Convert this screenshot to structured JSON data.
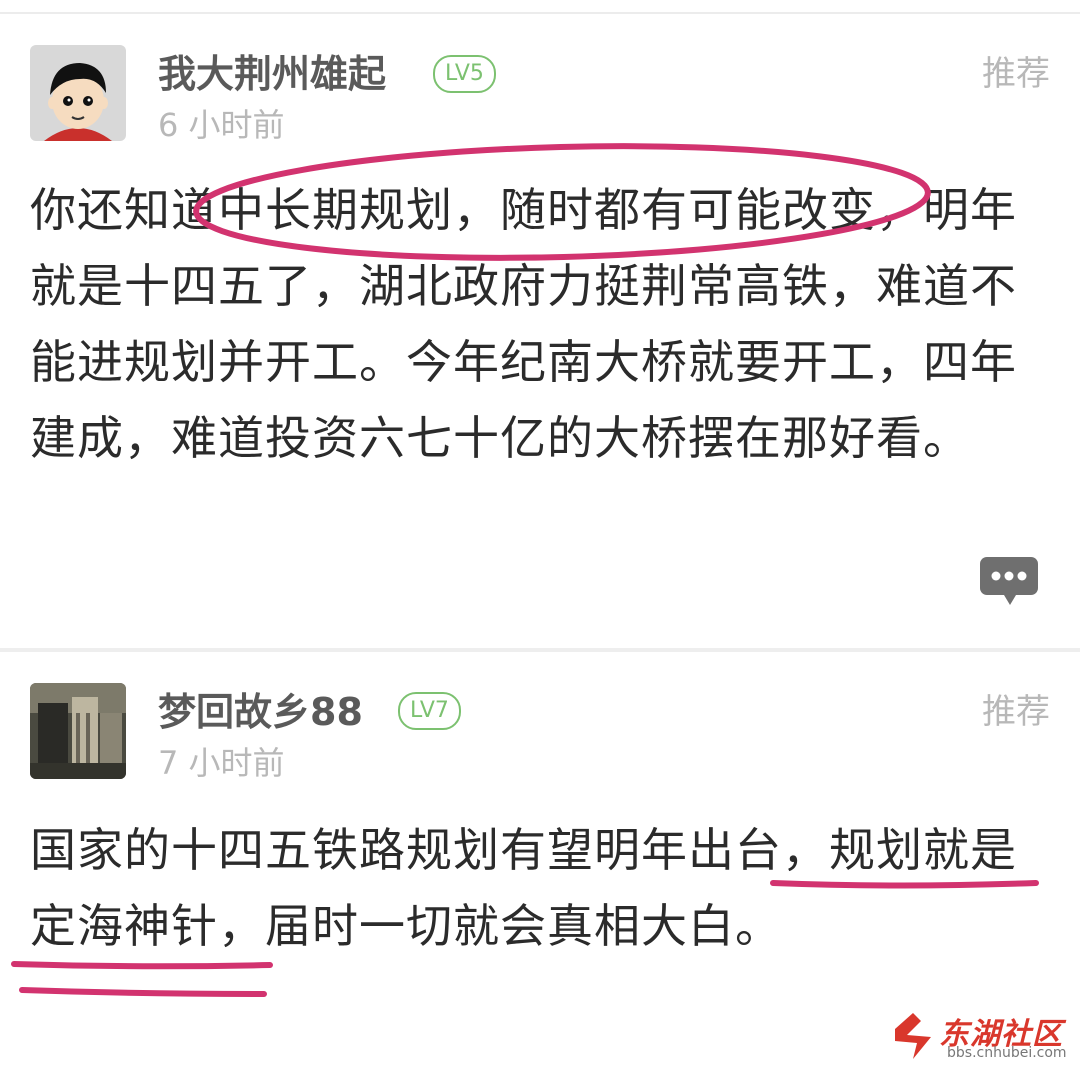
{
  "comments": [
    {
      "username": "我大荆州雄起",
      "level": "LV5",
      "time": "6 小时前",
      "recommend": "推荐",
      "content_lines": [
        "你还知道中长期规划，随时都有可能改变，明年",
        "就是十四五了，湖北政府力挺荆常高铁，难道不",
        "能进规划并开工。今年纪南大桥就要开工，四年",
        "建成，难道投资六七十亿的大桥摆在那好看。"
      ]
    },
    {
      "username": "梦回故乡88",
      "level": "LV7",
      "time": "7 小时前",
      "recommend": "推荐",
      "content_lines": [
        "国家的十四五铁路规划有望明年出台，规划就是",
        "定海神针，届时一切就会真相大白。"
      ]
    }
  ],
  "watermark": {
    "name": "东湖社区",
    "url": "bbs.cnhubei.com"
  },
  "colors": {
    "annotation": "#d2336f",
    "level_badge": "#7cc170",
    "watermark": "#d9372c"
  },
  "icons": {
    "more": "more-dots-bubble-icon",
    "avatar1": "cartoon-boy-avatar",
    "avatar2": "photo-avatar"
  }
}
